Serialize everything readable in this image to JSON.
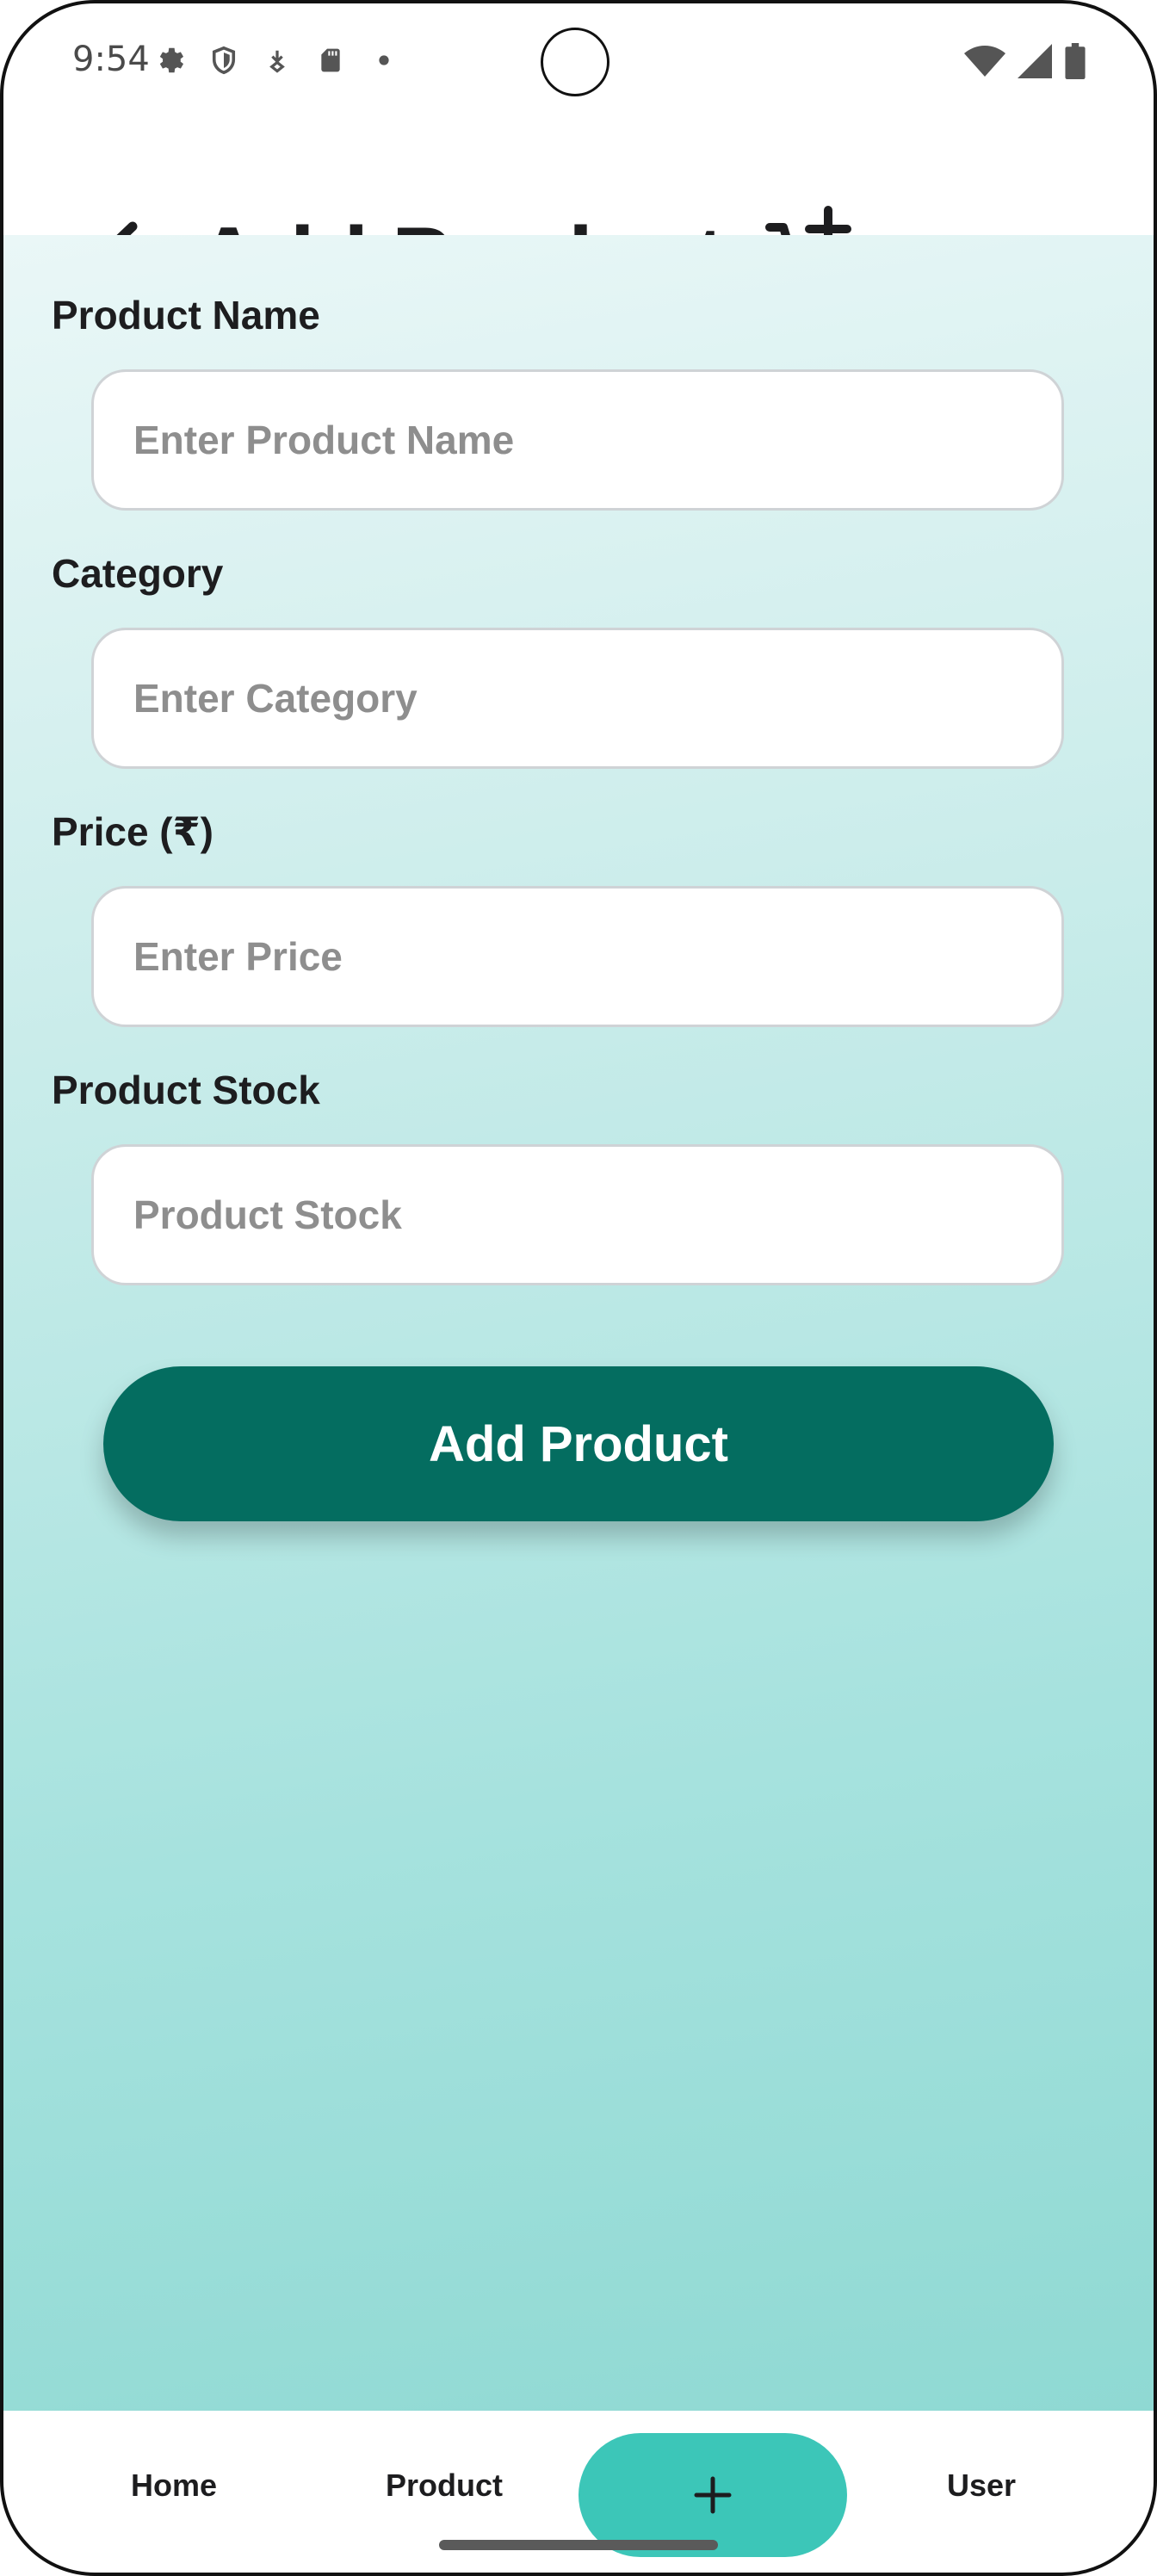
{
  "status_bar": {
    "time": "9:54",
    "left_icons": [
      "settings-icon",
      "shield-icon",
      "download-icon",
      "sd-card-icon",
      "dot-icon"
    ],
    "right_icons": [
      "wifi-icon",
      "signal-icon",
      "battery-icon"
    ]
  },
  "header": {
    "title": "Add Product",
    "back_icon": "back-arrow-icon",
    "action_icon": "cart-add-icon"
  },
  "form": {
    "fields": [
      {
        "label": "Product Name",
        "placeholder": "Enter Product Name",
        "value": ""
      },
      {
        "label": "Category",
        "placeholder": "Enter Category",
        "value": ""
      },
      {
        "label": "Price (₹)",
        "placeholder": "Enter Price",
        "value": ""
      },
      {
        "label": "Product Stock",
        "placeholder": "Product Stock",
        "value": ""
      }
    ],
    "submit_label": "Add Product"
  },
  "bottom_nav": {
    "items": [
      {
        "label": "Home"
      },
      {
        "label": "Product"
      },
      {
        "label": "User"
      }
    ],
    "add_icon": "plus-icon"
  },
  "colors": {
    "primary": "#046d60",
    "accent": "#3cc6b8",
    "text": "#1d1d1f",
    "placeholder": "#8e8e8e",
    "gradient_top": "#eaf7f7",
    "gradient_bottom": "#8fd9d3"
  }
}
